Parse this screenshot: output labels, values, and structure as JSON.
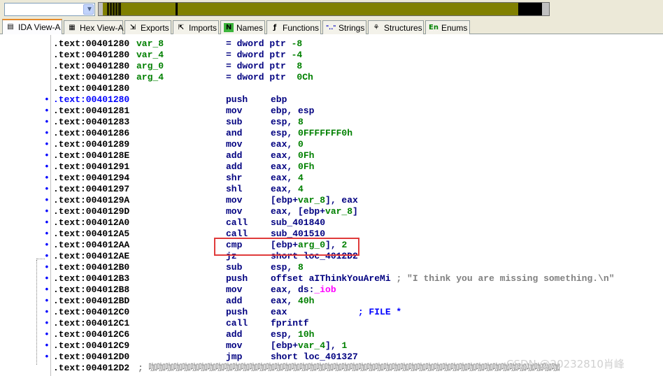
{
  "navigation": {
    "address_value": "",
    "dropdown_icon": "chevron-down-icon"
  },
  "tabs": [
    {
      "label": "IDA View-A",
      "icon": "ida-view-icon",
      "icon_glyph": "▤",
      "active": true
    },
    {
      "label": "Hex View-A",
      "icon": "hex-view-icon",
      "icon_glyph": "▦",
      "active": false
    },
    {
      "label": "Exports",
      "icon": "exports-icon",
      "icon_glyph": "⇲",
      "active": false
    },
    {
      "label": "Imports",
      "icon": "imports-icon",
      "icon_glyph": "⇱",
      "active": false
    },
    {
      "label": "Names",
      "icon": "names-icon",
      "icon_glyph": "N",
      "active": false
    },
    {
      "label": "Functions",
      "icon": "functions-icon",
      "icon_glyph": "ƒ",
      "active": false
    },
    {
      "label": "Strings",
      "icon": "strings-icon",
      "icon_glyph": "\"..\"",
      "active": false
    },
    {
      "label": "Structures",
      "icon": "structures-icon",
      "icon_glyph": "⚘",
      "active": false
    },
    {
      "label": "Enums",
      "icon": "enums-icon",
      "icon_glyph": "En",
      "active": false
    }
  ],
  "listing": {
    "rows": [
      {
        "bp": "",
        "addr": ".text:00401280",
        "label": "var_8",
        "mnemonic": "",
        "operand_html": "",
        "assign": "= dword ptr -8"
      },
      {
        "bp": "",
        "addr": ".text:00401280",
        "label": "var_4",
        "mnemonic": "",
        "operand_html": "",
        "assign": "= dword ptr -4"
      },
      {
        "bp": "",
        "addr": ".text:00401280",
        "label": "arg_0",
        "mnemonic": "",
        "operand_html": "",
        "assign": "= dword ptr  8"
      },
      {
        "bp": "",
        "addr": ".text:00401280",
        "label": "arg_4",
        "mnemonic": "",
        "operand_html": "",
        "assign": "= dword ptr  0Ch"
      },
      {
        "bp": "",
        "addr": ".text:00401280",
        "label": "",
        "mnemonic": "",
        "operand_html": "",
        "assign": ""
      },
      {
        "bp": "•",
        "addr": ".text:00401280",
        "label": "",
        "mnemonic": "push",
        "operand": "ebp",
        "selected": true
      },
      {
        "bp": "•",
        "addr": ".text:00401281",
        "label": "",
        "mnemonic": "mov",
        "operand": "ebp, esp"
      },
      {
        "bp": "•",
        "addr": ".text:00401283",
        "label": "",
        "mnemonic": "sub",
        "operand": "esp, 8"
      },
      {
        "bp": "•",
        "addr": ".text:00401286",
        "label": "",
        "mnemonic": "and",
        "operand": "esp, 0FFFFFFF0h"
      },
      {
        "bp": "•",
        "addr": ".text:00401289",
        "label": "",
        "mnemonic": "mov",
        "operand": "eax, 0"
      },
      {
        "bp": "•",
        "addr": ".text:0040128E",
        "label": "",
        "mnemonic": "add",
        "operand": "eax, 0Fh"
      },
      {
        "bp": "•",
        "addr": ".text:00401291",
        "label": "",
        "mnemonic": "add",
        "operand": "eax, 0Fh"
      },
      {
        "bp": "•",
        "addr": ".text:00401294",
        "label": "",
        "mnemonic": "shr",
        "operand": "eax, 4"
      },
      {
        "bp": "•",
        "addr": ".text:00401297",
        "label": "",
        "mnemonic": "shl",
        "operand": "eax, 4"
      },
      {
        "bp": "•",
        "addr": ".text:0040129A",
        "label": "",
        "mnemonic": "mov",
        "operand": "[ebp+var_8], eax"
      },
      {
        "bp": "•",
        "addr": ".text:0040129D",
        "label": "",
        "mnemonic": "mov",
        "operand": "eax, [ebp+var_8]"
      },
      {
        "bp": "•",
        "addr": ".text:004012A0",
        "label": "",
        "mnemonic": "call",
        "operand": "sub_401840"
      },
      {
        "bp": "•",
        "addr": ".text:004012A5",
        "label": "",
        "mnemonic": "call",
        "operand": "sub_401510"
      },
      {
        "bp": "•",
        "addr": ".text:004012AA",
        "label": "",
        "mnemonic": "cmp",
        "operand": "[ebp+arg_0], 2"
      },
      {
        "bp": "•",
        "addr": ".text:004012AE",
        "label": "",
        "mnemonic": "jz",
        "operand": "short loc_4012D2"
      },
      {
        "bp": "•",
        "addr": ".text:004012B0",
        "label": "",
        "mnemonic": "sub",
        "operand": "esp, 8"
      },
      {
        "bp": "•",
        "addr": ".text:004012B3",
        "label": "",
        "mnemonic": "push",
        "operand": "offset aIThinkYouAreMi",
        "comment": " ; \"I think you are missing something.\\n\""
      },
      {
        "bp": "•",
        "addr": ".text:004012B8",
        "label": "",
        "mnemonic": "mov",
        "operand": "eax, ds:_iob"
      },
      {
        "bp": "•",
        "addr": ".text:004012BD",
        "label": "",
        "mnemonic": "add",
        "operand": "eax, 40h"
      },
      {
        "bp": "•",
        "addr": ".text:004012C0",
        "label": "",
        "mnemonic": "push",
        "operand": "eax",
        "comment": "             ; FILE *"
      },
      {
        "bp": "•",
        "addr": ".text:004012C1",
        "label": "",
        "mnemonic": "call",
        "operand": "fprintf"
      },
      {
        "bp": "•",
        "addr": ".text:004012C6",
        "label": "",
        "mnemonic": "add",
        "operand": "esp, 10h"
      },
      {
        "bp": "•",
        "addr": ".text:004012C9",
        "label": "",
        "mnemonic": "mov",
        "operand": "[ebp+var_4], 1"
      },
      {
        "bp": "•",
        "addr": ".text:004012D0",
        "label": "",
        "mnemonic": "jmp",
        "operand": "short loc_401327"
      },
      {
        "bp": "",
        "addr": ".text:004012D2",
        "label": "",
        "mnemonic": "",
        "operand": "",
        "garbage_prefix": ";",
        "garbage": "咖咖咖咖咖咖咖咖咖咖咖咖咖咖咖咖咖咖咖咖咖咖咖咖咖咖咖咖咖咖咖咖咖咖咖咖咖咖咖咖咖咖咖咖咖咖咖咖咖"
      }
    ]
  },
  "watermark": "CSDN @20232810肖峰",
  "colors": {
    "highlight_box": "#e03b3b",
    "address": "#000000",
    "mnemonic": "#000080",
    "variable": "#008000",
    "import": "#ff00ff",
    "comment": "#808080"
  }
}
